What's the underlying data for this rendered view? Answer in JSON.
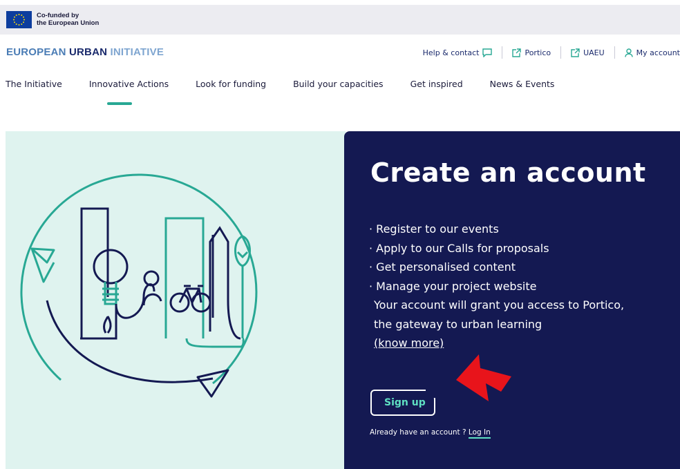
{
  "eu_bar": {
    "line1": "Co-funded by",
    "line2": "the European Union"
  },
  "brand": {
    "part1": "EUROPEAN ",
    "part2": "URBAN ",
    "part3": "INITIATIVE"
  },
  "utility_links": [
    {
      "label": "Help & contact",
      "icon": "chat-icon"
    },
    {
      "label": "Portico",
      "icon": "external-link-icon"
    },
    {
      "label": "UAEU",
      "icon": "external-link-icon"
    },
    {
      "label": "My account",
      "icon": "user-icon"
    }
  ],
  "nav": [
    {
      "label": "The Initiative"
    },
    {
      "label": "Innovative Actions",
      "active": true
    },
    {
      "label": "Look for funding"
    },
    {
      "label": "Build your capacities"
    },
    {
      "label": "Get inspired"
    },
    {
      "label": "News & Events"
    }
  ],
  "hero": {
    "title": "Create an account",
    "bullets": [
      "· Register to our events",
      "· Apply to our Calls for proposals",
      "· Get personalised content",
      "· Manage your project website"
    ],
    "description_line1": "Your account will grant you access to Portico,",
    "description_line2": "the gateway to urban learning",
    "know_more": "(know more)",
    "signup_label": "Sign up",
    "already_text": "Already have an account ? ",
    "login_label": "Log In"
  },
  "colors": {
    "accent": "#28a894",
    "navy": "#141952",
    "panel_light": "#dff3ef",
    "signup_text": "#5fe0c2",
    "annotation_arrow": "#e8141b"
  }
}
